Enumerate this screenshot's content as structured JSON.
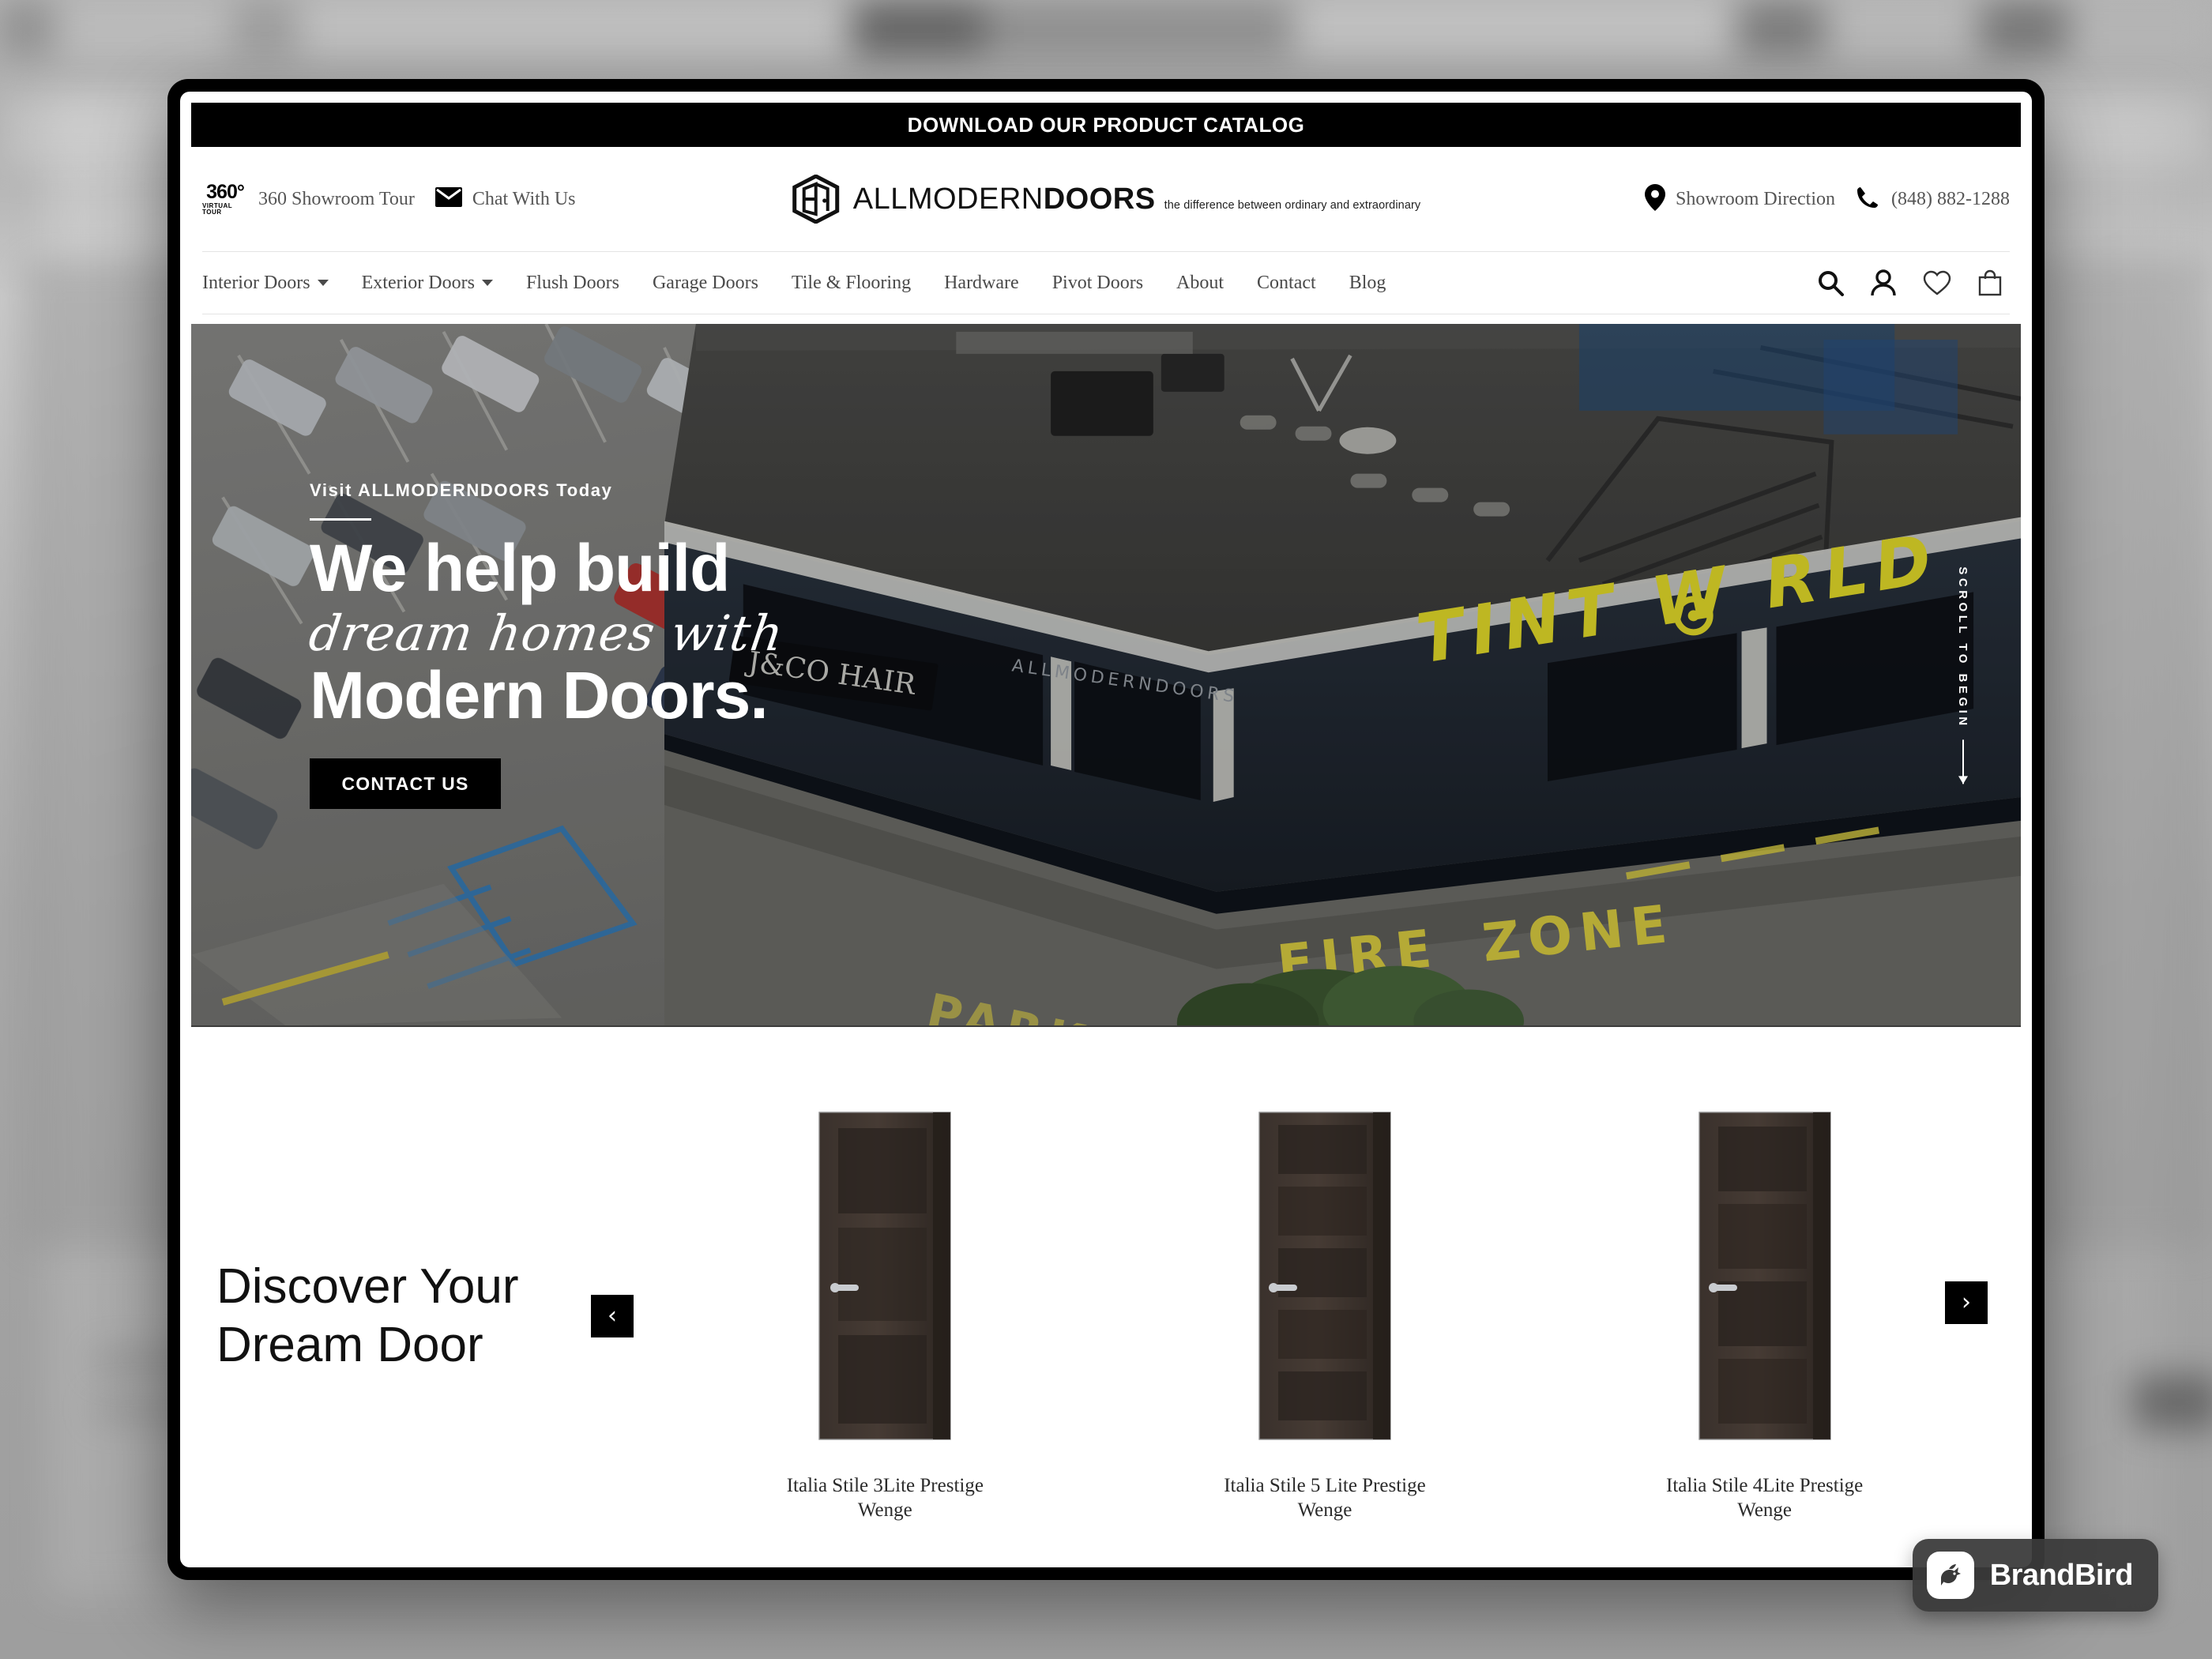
{
  "announcement": {
    "text": "DOWNLOAD OUR PRODUCT CATALOG"
  },
  "utility": {
    "tour": {
      "label": "360 Showroom Tour",
      "badge_main": "360°",
      "badge_sub": "VIRTUAL TOUR"
    },
    "chat": {
      "label": "Chat With Us",
      "icon": "envelope-icon"
    },
    "direction": {
      "label": "Showroom Direction",
      "icon": "map-pin-icon"
    },
    "phone": {
      "label": "(848) 882-1288",
      "icon": "phone-icon"
    }
  },
  "logo": {
    "name_bold": "ALLMODERN",
    "name_rest": "DOORS",
    "tagline": "the difference between ordinary and extraordinary"
  },
  "nav": {
    "items": [
      {
        "label": "Interior Doors",
        "has_dropdown": true
      },
      {
        "label": "Exterior Doors",
        "has_dropdown": true
      },
      {
        "label": "Flush Doors",
        "has_dropdown": false
      },
      {
        "label": "Garage Doors",
        "has_dropdown": false
      },
      {
        "label": "Tile & Flooring",
        "has_dropdown": false
      },
      {
        "label": "Hardware",
        "has_dropdown": false
      },
      {
        "label": "Pivot Doors",
        "has_dropdown": false
      },
      {
        "label": "About",
        "has_dropdown": false
      },
      {
        "label": "Contact",
        "has_dropdown": false
      },
      {
        "label": "Blog",
        "has_dropdown": false
      }
    ],
    "icons": [
      "search-icon",
      "account-icon",
      "wishlist-heart-icon",
      "shopping-bag-icon"
    ]
  },
  "hero": {
    "kicker": "Visit ALLMODERNDOORS Today",
    "line1": "We help build",
    "line2": "dream homes with",
    "line3": "Modern Doors.",
    "cta": "CONTACT US",
    "scroll_hint": "SCROLL TO BEGIN",
    "signage": [
      "TINT WORLD",
      "FIRE",
      "ZONE",
      "PARKING",
      "J&CO HAIR",
      "ALLMODERNDOORS"
    ]
  },
  "discover": {
    "title_line1": "Discover Your",
    "title_line2": "Dream Door",
    "prev_label": "‹",
    "next_label": "›",
    "products": [
      {
        "name": "Italia Stile 3Lite Prestige Wenge",
        "panels": 3
      },
      {
        "name": "Italia Stile 5 Lite Prestige Wenge",
        "panels": 5
      },
      {
        "name": "Italia Stile 4Lite Prestige Wenge",
        "panels": 4
      }
    ]
  },
  "watermark": {
    "text": "BrandBird",
    "icon": "brandbird-logo-icon"
  },
  "colors": {
    "accent_black": "#000000",
    "text_muted": "#555555",
    "page_bg": "#ffffff",
    "watermark_bg": "#3a3a3a"
  }
}
